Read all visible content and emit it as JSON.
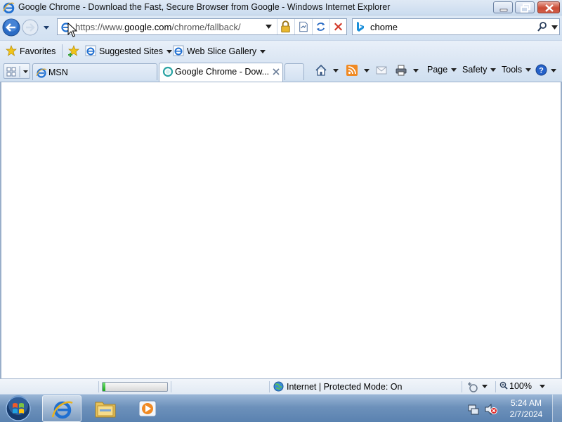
{
  "window": {
    "title": "Google Chrome - Download the Fast, Secure Browser from Google - Windows Internet Explorer"
  },
  "address_bar": {
    "url_prefix": "https://www.",
    "url_domain": "google.com",
    "url_path": "/chrome/fallback/"
  },
  "search_box": {
    "value": "chome",
    "provider_icon": "bing-icon"
  },
  "favorites_bar": {
    "favorites_label": "Favorites",
    "items": [
      {
        "label": "Suggested Sites"
      },
      {
        "label": "Web Slice Gallery"
      }
    ]
  },
  "tabs": [
    {
      "label": "MSN",
      "active": false
    },
    {
      "label": "Google Chrome - Dow...",
      "active": true
    }
  ],
  "command_bar": {
    "page": "Page",
    "safety": "Safety",
    "tools": "Tools"
  },
  "status_bar": {
    "progress": 0.04,
    "zone": "Internet | Protected Mode: On",
    "zoom": "100%"
  },
  "taskbar": {
    "time": "5:24 AM",
    "date": "2/7/2024"
  },
  "colors": {
    "accent": "#2a6bc4",
    "progress": "#22b022"
  }
}
